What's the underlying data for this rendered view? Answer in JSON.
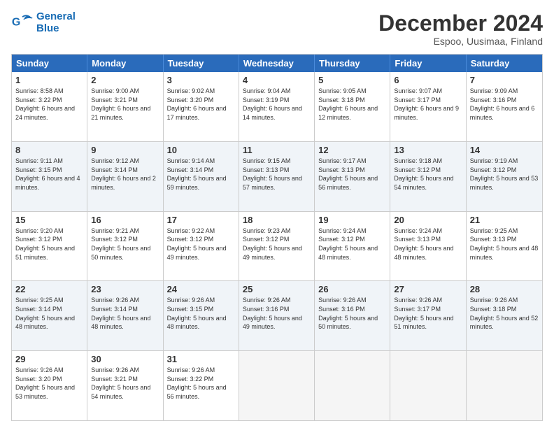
{
  "logo": {
    "line1": "General",
    "line2": "Blue"
  },
  "header": {
    "month": "December 2024",
    "location": "Espoo, Uusimaa, Finland"
  },
  "weekdays": [
    "Sunday",
    "Monday",
    "Tuesday",
    "Wednesday",
    "Thursday",
    "Friday",
    "Saturday"
  ],
  "rows": [
    [
      {
        "day": "1",
        "sunrise": "Sunrise: 8:58 AM",
        "sunset": "Sunset: 3:22 PM",
        "daylight": "Daylight: 6 hours and 24 minutes."
      },
      {
        "day": "2",
        "sunrise": "Sunrise: 9:00 AM",
        "sunset": "Sunset: 3:21 PM",
        "daylight": "Daylight: 6 hours and 21 minutes."
      },
      {
        "day": "3",
        "sunrise": "Sunrise: 9:02 AM",
        "sunset": "Sunset: 3:20 PM",
        "daylight": "Daylight: 6 hours and 17 minutes."
      },
      {
        "day": "4",
        "sunrise": "Sunrise: 9:04 AM",
        "sunset": "Sunset: 3:19 PM",
        "daylight": "Daylight: 6 hours and 14 minutes."
      },
      {
        "day": "5",
        "sunrise": "Sunrise: 9:05 AM",
        "sunset": "Sunset: 3:18 PM",
        "daylight": "Daylight: 6 hours and 12 minutes."
      },
      {
        "day": "6",
        "sunrise": "Sunrise: 9:07 AM",
        "sunset": "Sunset: 3:17 PM",
        "daylight": "Daylight: 6 hours and 9 minutes."
      },
      {
        "day": "7",
        "sunrise": "Sunrise: 9:09 AM",
        "sunset": "Sunset: 3:16 PM",
        "daylight": "Daylight: 6 hours and 6 minutes."
      }
    ],
    [
      {
        "day": "8",
        "sunrise": "Sunrise: 9:11 AM",
        "sunset": "Sunset: 3:15 PM",
        "daylight": "Daylight: 6 hours and 4 minutes."
      },
      {
        "day": "9",
        "sunrise": "Sunrise: 9:12 AM",
        "sunset": "Sunset: 3:14 PM",
        "daylight": "Daylight: 6 hours and 2 minutes."
      },
      {
        "day": "10",
        "sunrise": "Sunrise: 9:14 AM",
        "sunset": "Sunset: 3:14 PM",
        "daylight": "Daylight: 5 hours and 59 minutes."
      },
      {
        "day": "11",
        "sunrise": "Sunrise: 9:15 AM",
        "sunset": "Sunset: 3:13 PM",
        "daylight": "Daylight: 5 hours and 57 minutes."
      },
      {
        "day": "12",
        "sunrise": "Sunrise: 9:17 AM",
        "sunset": "Sunset: 3:13 PM",
        "daylight": "Daylight: 5 hours and 56 minutes."
      },
      {
        "day": "13",
        "sunrise": "Sunrise: 9:18 AM",
        "sunset": "Sunset: 3:12 PM",
        "daylight": "Daylight: 5 hours and 54 minutes."
      },
      {
        "day": "14",
        "sunrise": "Sunrise: 9:19 AM",
        "sunset": "Sunset: 3:12 PM",
        "daylight": "Daylight: 5 hours and 53 minutes."
      }
    ],
    [
      {
        "day": "15",
        "sunrise": "Sunrise: 9:20 AM",
        "sunset": "Sunset: 3:12 PM",
        "daylight": "Daylight: 5 hours and 51 minutes."
      },
      {
        "day": "16",
        "sunrise": "Sunrise: 9:21 AM",
        "sunset": "Sunset: 3:12 PM",
        "daylight": "Daylight: 5 hours and 50 minutes."
      },
      {
        "day": "17",
        "sunrise": "Sunrise: 9:22 AM",
        "sunset": "Sunset: 3:12 PM",
        "daylight": "Daylight: 5 hours and 49 minutes."
      },
      {
        "day": "18",
        "sunrise": "Sunrise: 9:23 AM",
        "sunset": "Sunset: 3:12 PM",
        "daylight": "Daylight: 5 hours and 49 minutes."
      },
      {
        "day": "19",
        "sunrise": "Sunrise: 9:24 AM",
        "sunset": "Sunset: 3:12 PM",
        "daylight": "Daylight: 5 hours and 48 minutes."
      },
      {
        "day": "20",
        "sunrise": "Sunrise: 9:24 AM",
        "sunset": "Sunset: 3:13 PM",
        "daylight": "Daylight: 5 hours and 48 minutes."
      },
      {
        "day": "21",
        "sunrise": "Sunrise: 9:25 AM",
        "sunset": "Sunset: 3:13 PM",
        "daylight": "Daylight: 5 hours and 48 minutes."
      }
    ],
    [
      {
        "day": "22",
        "sunrise": "Sunrise: 9:25 AM",
        "sunset": "Sunset: 3:14 PM",
        "daylight": "Daylight: 5 hours and 48 minutes."
      },
      {
        "day": "23",
        "sunrise": "Sunrise: 9:26 AM",
        "sunset": "Sunset: 3:14 PM",
        "daylight": "Daylight: 5 hours and 48 minutes."
      },
      {
        "day": "24",
        "sunrise": "Sunrise: 9:26 AM",
        "sunset": "Sunset: 3:15 PM",
        "daylight": "Daylight: 5 hours and 48 minutes."
      },
      {
        "day": "25",
        "sunrise": "Sunrise: 9:26 AM",
        "sunset": "Sunset: 3:16 PM",
        "daylight": "Daylight: 5 hours and 49 minutes."
      },
      {
        "day": "26",
        "sunrise": "Sunrise: 9:26 AM",
        "sunset": "Sunset: 3:16 PM",
        "daylight": "Daylight: 5 hours and 50 minutes."
      },
      {
        "day": "27",
        "sunrise": "Sunrise: 9:26 AM",
        "sunset": "Sunset: 3:17 PM",
        "daylight": "Daylight: 5 hours and 51 minutes."
      },
      {
        "day": "28",
        "sunrise": "Sunrise: 9:26 AM",
        "sunset": "Sunset: 3:18 PM",
        "daylight": "Daylight: 5 hours and 52 minutes."
      }
    ],
    [
      {
        "day": "29",
        "sunrise": "Sunrise: 9:26 AM",
        "sunset": "Sunset: 3:20 PM",
        "daylight": "Daylight: 5 hours and 53 minutes."
      },
      {
        "day": "30",
        "sunrise": "Sunrise: 9:26 AM",
        "sunset": "Sunset: 3:21 PM",
        "daylight": "Daylight: 5 hours and 54 minutes."
      },
      {
        "day": "31",
        "sunrise": "Sunrise: 9:26 AM",
        "sunset": "Sunset: 3:22 PM",
        "daylight": "Daylight: 5 hours and 56 minutes."
      },
      null,
      null,
      null,
      null
    ]
  ]
}
